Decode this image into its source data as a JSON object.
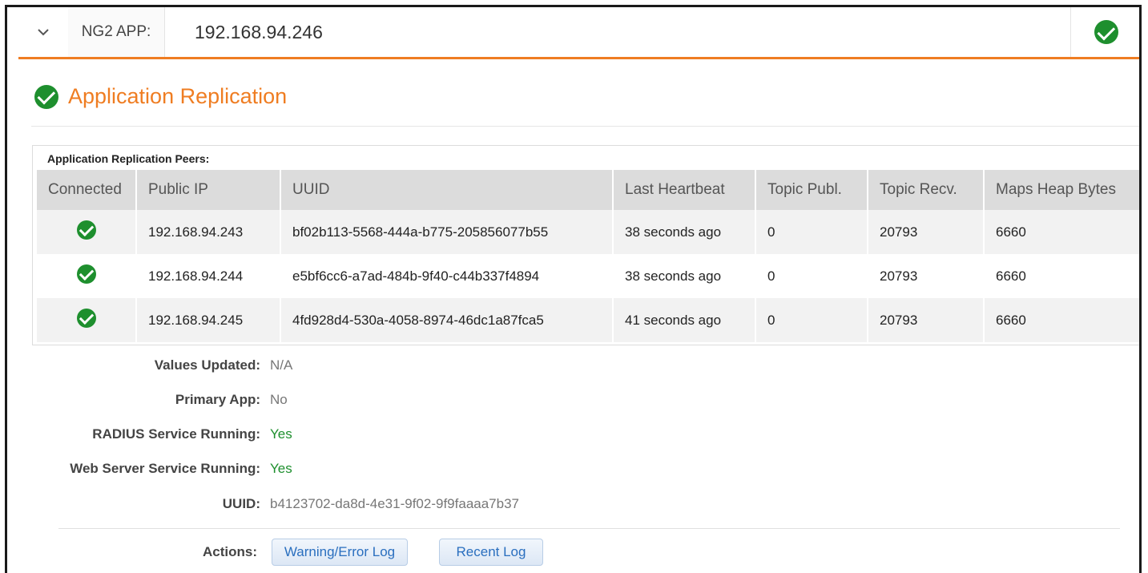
{
  "header": {
    "label": "NG2 APP:",
    "ip": "192.168.94.246",
    "status_icon": "check-circle-icon",
    "accent_color": "#ef7d22",
    "ok_color": "#1e8f2e"
  },
  "section": {
    "title": "Application Replication",
    "peers_caption": "Application Replication Peers:"
  },
  "peers_table": {
    "columns": [
      "Connected",
      "Public IP",
      "UUID",
      "Last Heartbeat",
      "Topic Publ.",
      "Topic Recv.",
      "Maps Heap Bytes"
    ],
    "rows": [
      {
        "connected": "check-circle-icon",
        "public_ip": "192.168.94.243",
        "uuid": "bf02b113-5568-444a-b775-205856077b55",
        "last_heartbeat": "38 seconds ago",
        "topic_publ": "0",
        "topic_recv": "20793",
        "maps_heap_bytes": "6660"
      },
      {
        "connected": "check-circle-icon",
        "public_ip": "192.168.94.244",
        "uuid": "e5bf6cc6-a7ad-484b-9f40-c44b337f4894",
        "last_heartbeat": "38 seconds ago",
        "topic_publ": "0",
        "topic_recv": "20793",
        "maps_heap_bytes": "6660"
      },
      {
        "connected": "check-circle-icon",
        "public_ip": "192.168.94.245",
        "uuid": "4fd928d4-530a-4058-8974-46dc1a87fca5",
        "last_heartbeat": "41 seconds ago",
        "topic_publ": "0",
        "topic_recv": "20793",
        "maps_heap_bytes": "6660"
      }
    ]
  },
  "info": {
    "values_updated_label": "Values Updated:",
    "values_updated": "N/A",
    "primary_app_label": "Primary App:",
    "primary_app": "No",
    "radius_label": "RADIUS Service Running:",
    "radius": "Yes",
    "web_server_label": "Web Server Service Running:",
    "web_server": "Yes",
    "uuid_label": "UUID:",
    "uuid": "b4123702-da8d-4e31-9f02-9f9faaaa7b37"
  },
  "actions": {
    "label": "Actions:",
    "warning_log": "Warning/Error Log",
    "recent_log": "Recent Log"
  }
}
